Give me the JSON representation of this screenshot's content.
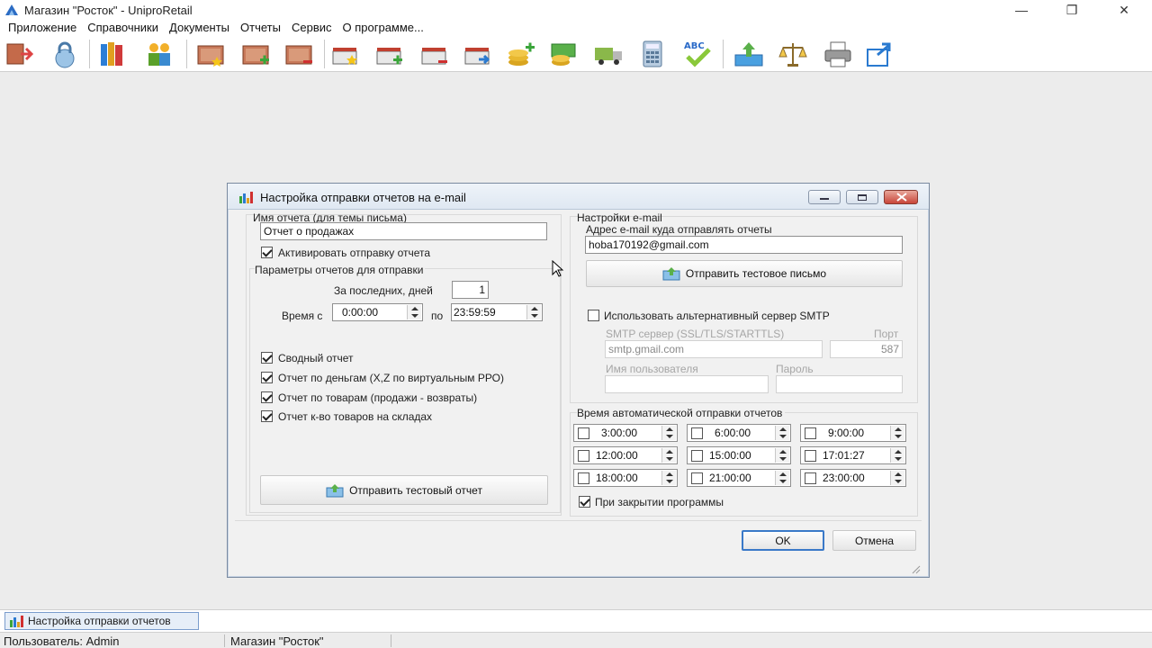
{
  "window": {
    "title": "Магазин \"Росток\" - UniproRetail",
    "minimize": "—",
    "maximize": "❐",
    "close": "✕"
  },
  "menu": [
    "Приложение",
    "Справочники",
    "Документы",
    "Отчеты",
    "Сервис",
    "О программе..."
  ],
  "toolbar": {
    "icons": [
      "exit-icon",
      "lock-icon",
      "books-icon",
      "users-icon",
      "folder-star-icon",
      "folder-add-icon",
      "folder-remove-icon",
      "box-star-icon",
      "box-add-icon",
      "box-remove-icon",
      "box-arrow-icon",
      "coins-add-icon",
      "money-icon",
      "truck-icon",
      "calculator-icon",
      "spellcheck-icon",
      "upload-icon",
      "scales-icon",
      "printer-icon",
      "export-icon"
    ],
    "spellcheck_text": "ABC"
  },
  "dialog": {
    "title": "Настройка отправки отчетов на e-mail",
    "report_name_label": "Имя отчета (для темы письма)",
    "report_name_value": "Отчет о продажах",
    "activate_label": "Активировать отправку отчета",
    "params_label": "Параметры отчетов для отправки",
    "last_days_label": "За последних, дней",
    "last_days_value": "1",
    "time_from_label": "Время с",
    "time_from_value": "0:00:00",
    "time_to_label": "по",
    "time_to_value": "23:59:59",
    "reports": [
      {
        "label": "Сводный отчет",
        "checked": true
      },
      {
        "label": "Отчет по деньгам (X,Z по виртуальным РРО)",
        "checked": true
      },
      {
        "label": "Отчет по товарам (продажи - возвраты)",
        "checked": true
      },
      {
        "label": "Отчет к-во товаров на складах",
        "checked": true
      }
    ],
    "send_test_report": "Отправить тестовый отчет",
    "email_settings_label": "Настройки e-mail",
    "email_to_label": "Адрес e-mail куда отправлять отчеты",
    "email_to_value": "hoba170192@gmail.com",
    "send_test_letter": "Отправить тестовое письмо",
    "alt_smtp_label": "Использовать альтернативный сервер SMTP",
    "smtp_server_label": "SMTP сервер  (SSL/TLS/STARTTLS)",
    "smtp_server_value": "smtp.gmail.com",
    "port_label": "Порт",
    "port_value": "587",
    "username_label": "Имя пользователя",
    "password_label": "Пароль",
    "auto_time_label": "Время автоматической отправки отчетов",
    "times": [
      "3:00:00",
      "6:00:00",
      "9:00:00",
      "12:00:00",
      "15:00:00",
      "17:01:27",
      "18:00:00",
      "21:00:00",
      "23:00:00"
    ],
    "on_close_label": "При закрытии программы",
    "ok": "OK",
    "cancel": "Отмена"
  },
  "taskbar": {
    "item": "Настройка отправки отчетов"
  },
  "status": {
    "user": "Пользователь: Admin",
    "store": "Магазин \"Росток\""
  }
}
